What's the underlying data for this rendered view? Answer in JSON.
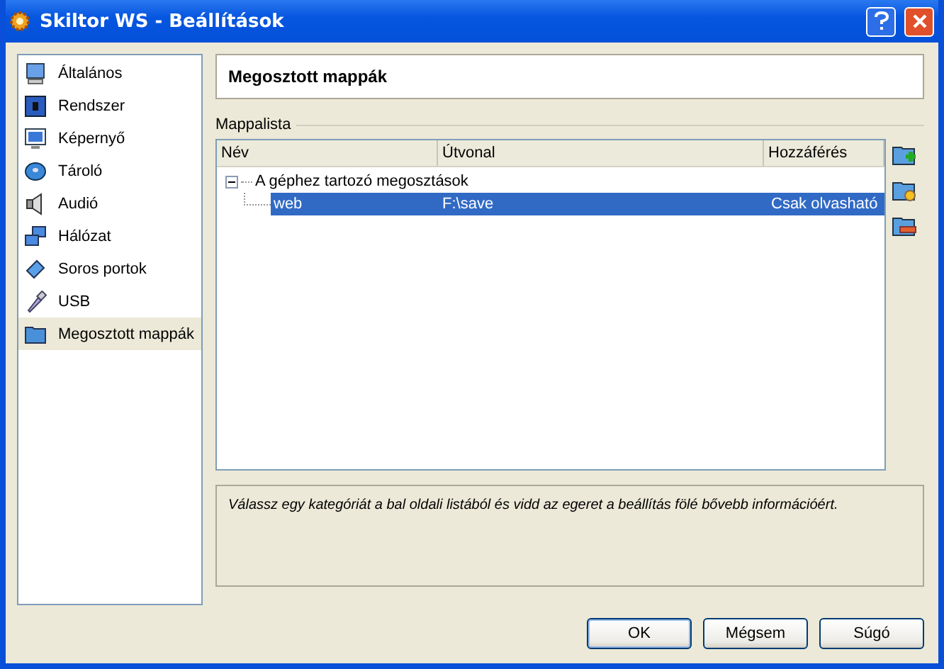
{
  "window": {
    "title": "Skiltor WS - Beállítások"
  },
  "sidebar": {
    "items": [
      {
        "label": "Általános",
        "selected": false
      },
      {
        "label": "Rendszer",
        "selected": false
      },
      {
        "label": "Képernyő",
        "selected": false
      },
      {
        "label": "Tároló",
        "selected": false
      },
      {
        "label": "Audió",
        "selected": false
      },
      {
        "label": "Hálózat",
        "selected": false
      },
      {
        "label": "Soros portok",
        "selected": false
      },
      {
        "label": "USB",
        "selected": false
      },
      {
        "label": "Megosztott mappák",
        "selected": true
      }
    ]
  },
  "page_title": "Megosztott mappák",
  "group_label": "Mappalista",
  "table": {
    "columns": [
      "Név",
      "Útvonal",
      "Hozzáférés"
    ],
    "rows": [
      {
        "name": "A géphez tartozó megosztások",
        "expanded": true,
        "selected": false,
        "children": [
          {
            "name": "web",
            "path": "F:\\save",
            "access": "Csak olvasható",
            "selected": true
          }
        ]
      }
    ]
  },
  "info": "Válassz egy kategóriát a bal oldali listából és vidd az egeret a beállítás fölé bővebb információért.",
  "buttons": [
    "OK",
    "Mégsem",
    "Súgó"
  ]
}
